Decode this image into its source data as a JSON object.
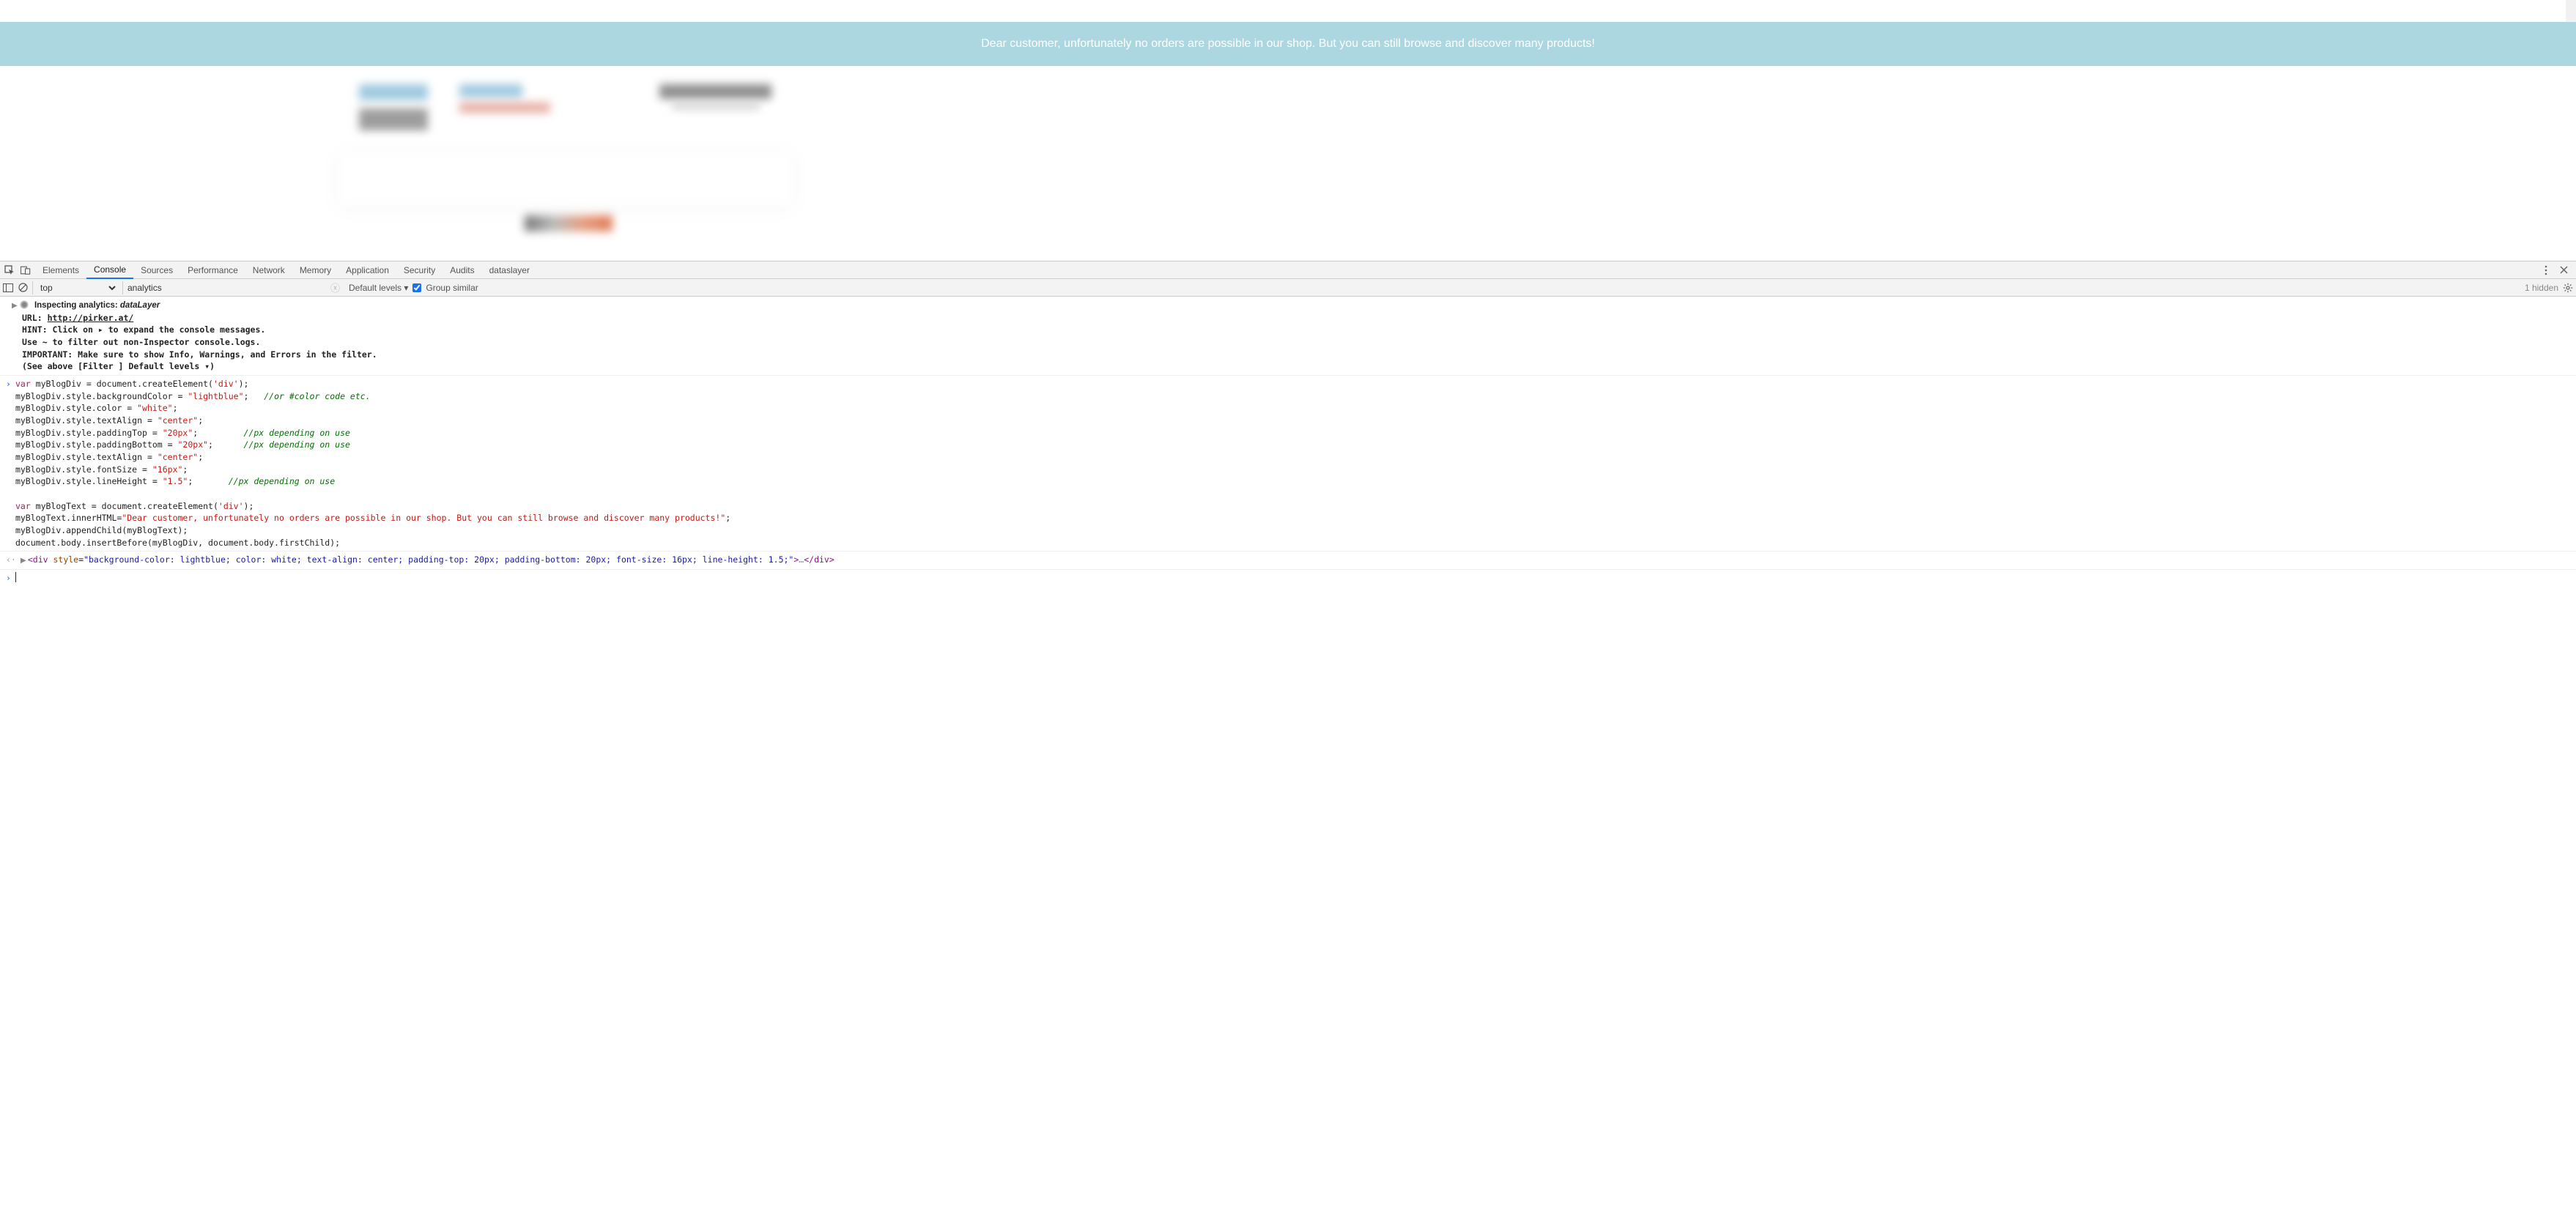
{
  "banner": {
    "message": "Dear customer, unfortunately no orders are possible in our shop. But you can still browse and discover many products!"
  },
  "devtools": {
    "tabs": [
      "Elements",
      "Console",
      "Sources",
      "Performance",
      "Network",
      "Memory",
      "Application",
      "Security",
      "Audits",
      "dataslayer"
    ],
    "active_tab": "Console",
    "context": "top",
    "filter_value": "analytics",
    "levels_label": "Default levels ▾",
    "group_similar_label": "Group similar",
    "hidden_label": "1 hidden"
  },
  "inspector": {
    "title_prefix": "Inspecting analytics: ",
    "title_subject": "dataLayer",
    "url_label": "URL:  ",
    "url": "http://pirker.at/",
    "hint1": "HINT: Click on ▸ to expand the console messages.",
    "hint2": "      Use ~ to filter out non-Inspector console.logs.",
    "important1": "IMPORTANT: Make sure to show Info, Warnings, and Errors in the filter.",
    "important2": "           (See above [Filter   ] Default levels ▾)"
  },
  "snippet": {
    "l1a": "var",
    "l1b": " myBlogDiv = document.createElement(",
    "l1c": "'div'",
    "l1d": ");",
    "l2a": "myBlogDiv.style.backgroundColor = ",
    "l2b": "\"lightblue\"",
    "l2c": ";   ",
    "l2d": "//or #color code etc.",
    "l3a": "myBlogDiv.style.color = ",
    "l3b": "\"white\"",
    "l3c": ";",
    "l4a": "myBlogDiv.style.textAlign = ",
    "l4b": "\"center\"",
    "l4c": ";",
    "l5a": "myBlogDiv.style.paddingTop = ",
    "l5b": "\"20px\"",
    "l5c": ";         ",
    "l5d": "//px depending on use",
    "l6a": "myBlogDiv.style.paddingBottom = ",
    "l6b": "\"20px\"",
    "l6c": ";      ",
    "l6d": "//px depending on use",
    "l7a": "myBlogDiv.style.textAlign = ",
    "l7b": "\"center\"",
    "l7c": ";",
    "l8a": "myBlogDiv.style.fontSize = ",
    "l8b": "\"16px\"",
    "l8c": ";",
    "l9a": "myBlogDiv.style.lineHeight = ",
    "l9b": "\"1.5\"",
    "l9c": ";       ",
    "l9d": "//px depending on use",
    "l10": " ",
    "l11a": "var",
    "l11b": " myBlogText = document.createElement(",
    "l11c": "'div'",
    "l11d": ");",
    "l12a": "myBlogText.innerHTML=",
    "l12b": "\"Dear customer, unfortunately no orders are possible in our shop. But you can still browse and discover many products!\"",
    "l12c": ";",
    "l13": "myBlogDiv.appendChild(myBlogText);",
    "l14": "document.body.insertBefore(myBlogDiv, document.body.firstChild);"
  },
  "result": {
    "open": "<div ",
    "attr": "style",
    "eq": "=",
    "val": "\"background-color: lightblue; color: white; text-align: center; padding-top: 20px; padding-bottom: 20px; font-size: 16px; line-height: 1.5;\"",
    "gt": ">",
    "dots": "…",
    "close": "</div>"
  }
}
